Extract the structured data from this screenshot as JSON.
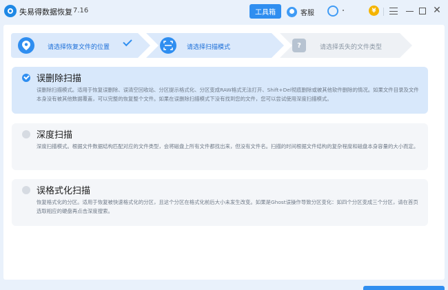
{
  "titlebar": {
    "app_title": "失易得数据恢复",
    "version": "7.16",
    "toolbox_label": "工具箱",
    "service_label": "客服",
    "qq_dot": "·",
    "coin_symbol": "¥",
    "close_symbol": "✕"
  },
  "steps": [
    {
      "label": "请选择恢复文件的位置",
      "state": "done"
    },
    {
      "label": "请选择扫描模式",
      "state": "active"
    },
    {
      "label": "请选择丢失的文件类型",
      "state": "pending",
      "icon_glyph": "?"
    }
  ],
  "options": [
    {
      "title": "误删除扫描",
      "selected": true,
      "description": "误删除扫描模式。适用于恢复误删除、误清空回收站、分区提示格式化、分区变成RAW格式无法打开、Shift+Del彻底删除或被其他软件删除的情况。如果文件目录及文件本身没有被其他数据覆盖，可以完整的恢复整个文件。如果在误删除扫描模式下没有找到您的文件，您可以尝试使用深度扫描模式。"
    },
    {
      "title": "深度扫描",
      "selected": false,
      "description": "深度扫描模式。根据文件数据结构匹配对应的文件类型，会将磁盘上所有文件都找出来，但没有文件名。扫描的时间根据文件结构的复杂程度和磁盘本身容量的大小而定。"
    },
    {
      "title": "误格式化扫描",
      "selected": false,
      "description": "恢复格式化的分区。适用于恢复被快速格式化的分区，且这个分区在格式化前后大小未发生改变。如果是Ghost误操作导致分区变化：如四个分区变成三个分区，请在首页选取相应的硬盘再点击深度搜索。"
    }
  ],
  "colors": {
    "accent": "#2f8ef0",
    "selected_bg": "#d8e8fb",
    "step_active_bg": "#dbe9fb",
    "step_pending_bg": "#eef1f5"
  }
}
